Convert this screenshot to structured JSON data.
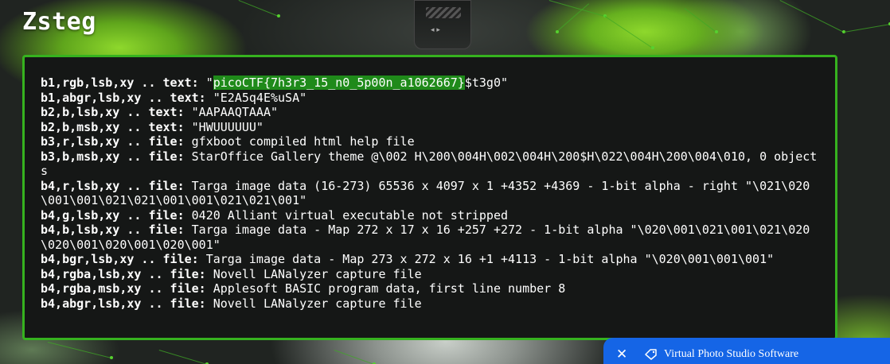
{
  "page": {
    "title": "Zsteg"
  },
  "terminal": {
    "lines": [
      {
        "key": "b1,rgb,lsb,xy .. text:",
        "pre": " \"",
        "highlight": "picoCTF{7h3r3_15_n0_5p00n_a1062667}",
        "post": "$t3g0\""
      },
      {
        "key": "b1,abgr,lsb,xy .. text:",
        "pre": " \"E2A5q4E%uSA\"",
        "highlight": "",
        "post": ""
      },
      {
        "key": "b2,b,lsb,xy .. text:",
        "pre": " \"AAPAAQTAAA\"",
        "highlight": "",
        "post": ""
      },
      {
        "key": "b2,b,msb,xy .. text:",
        "pre": " \"HWUUUUUU\"",
        "highlight": "",
        "post": ""
      },
      {
        "key": "b3,r,lsb,xy .. file:",
        "pre": " gfxboot compiled html help file",
        "highlight": "",
        "post": ""
      },
      {
        "key": "b3,b,msb,xy .. file:",
        "pre": " StarOffice Gallery theme @\\002 H\\200\\004H\\002\\004H\\200$H\\022\\004H\\200\\004\\010, 0 objects",
        "highlight": "",
        "post": ""
      },
      {
        "key": "b4,r,lsb,xy .. file:",
        "pre": " Targa image data (16-273) 65536 x 4097 x 1 +4352 +4369 - 1-bit alpha - right \"\\021\\020\\001\\001\\021\\021\\001\\001\\021\\021\\001\"",
        "highlight": "",
        "post": ""
      },
      {
        "key": "b4,g,lsb,xy .. file:",
        "pre": " 0420 Alliant virtual executable not stripped",
        "highlight": "",
        "post": ""
      },
      {
        "key": "b4,b,lsb,xy .. file:",
        "pre": " Targa image data - Map 272 x 17 x 16 +257 +272 - 1-bit alpha \"\\020\\001\\021\\001\\021\\020\\020\\001\\020\\001\\020\\001\"",
        "highlight": "",
        "post": ""
      },
      {
        "key": "b4,bgr,lsb,xy .. file:",
        "pre": " Targa image data - Map 273 x 272 x 16 +1 +4113 - 1-bit alpha \"\\020\\001\\001\\001\"",
        "highlight": "",
        "post": ""
      },
      {
        "key": "b4,rgba,lsb,xy .. file:",
        "pre": " Novell LANalyzer capture file",
        "highlight": "",
        "post": ""
      },
      {
        "key": "b4,rgba,msb,xy .. file:",
        "pre": " Applesoft BASIC program data, first line number 8",
        "highlight": "",
        "post": ""
      },
      {
        "key": "b4,abgr,lsb,xy .. file:",
        "pre": " Novell LANalyzer capture file",
        "highlight": "",
        "post": ""
      }
    ]
  },
  "popup": {
    "close_icon": "close-icon",
    "tag_icon": "tag-icon",
    "label": "Virtual Photo Studio Software"
  },
  "colors": {
    "panel_border": "#36b21f",
    "highlight": "#1f8a1a",
    "popup_bg": "#1565e6"
  }
}
